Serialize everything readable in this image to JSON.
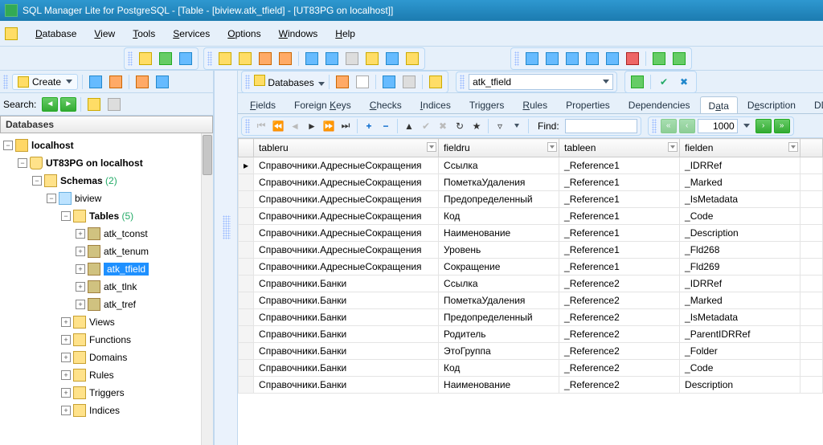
{
  "title": "SQL Manager Lite for PostgreSQL - [Table - [biview.atk_tfield] - [UT83PG on localhost]]",
  "menu": {
    "database": "Database",
    "view": "View",
    "tools": "Tools",
    "services": "Services",
    "options": "Options",
    "windows": "Windows",
    "help": "Help"
  },
  "left": {
    "create_label": "Create",
    "search_label": "Search:",
    "panel_title": "Databases",
    "host": "localhost",
    "db": "UT83PG on localhost",
    "schemas_label": "Schemas",
    "schemas_count": "(2)",
    "schema_name": "biview",
    "tables_label": "Tables",
    "tables_count": "(5)",
    "tables": [
      "atk_tconst",
      "atk_tenum",
      "atk_tfield",
      "atk_tlnk",
      "atk_tref"
    ],
    "views": "Views",
    "functions": "Functions",
    "domains": "Domains",
    "rules": "Rules",
    "triggers": "Triggers",
    "indices": "Indices"
  },
  "right": {
    "databases_label": "Databases",
    "selected_table": "atk_tfield",
    "tabs": [
      "Fields",
      "Foreign Keys",
      "Checks",
      "Indices",
      "Triggers",
      "Rules",
      "Properties",
      "Dependencies",
      "Data",
      "Description",
      "DD"
    ],
    "active_tab": 8,
    "find_label": "Find:",
    "find_value": "",
    "page_count": "1000",
    "columns": [
      "tableru",
      "fieldru",
      "tableen",
      "fielden"
    ],
    "rows": [
      [
        "Справочники.АдресныеСокращения",
        "Ссылка",
        "_Reference1",
        "_IDRRef"
      ],
      [
        "Справочники.АдресныеСокращения",
        "ПометкаУдаления",
        "_Reference1",
        "_Marked"
      ],
      [
        "Справочники.АдресныеСокращения",
        "Предопределенный",
        "_Reference1",
        "_IsMetadata"
      ],
      [
        "Справочники.АдресныеСокращения",
        "Код",
        "_Reference1",
        "_Code"
      ],
      [
        "Справочники.АдресныеСокращения",
        "Наименование",
        "_Reference1",
        "_Description"
      ],
      [
        "Справочники.АдресныеСокращения",
        "Уровень",
        "_Reference1",
        "_Fld268"
      ],
      [
        "Справочники.АдресныеСокращения",
        "Сокращение",
        "_Reference1",
        "_Fld269"
      ],
      [
        "Справочники.Банки",
        "Ссылка",
        "_Reference2",
        "_IDRRef"
      ],
      [
        "Справочники.Банки",
        "ПометкаУдаления",
        "_Reference2",
        "_Marked"
      ],
      [
        "Справочники.Банки",
        "Предопределенный",
        "_Reference2",
        "_IsMetadata"
      ],
      [
        "Справочники.Банки",
        "Родитель",
        "_Reference2",
        "_ParentIDRRef"
      ],
      [
        "Справочники.Банки",
        "ЭтоГруппа",
        "_Reference2",
        "_Folder"
      ],
      [
        "Справочники.Банки",
        "Код",
        "_Reference2",
        "_Code"
      ],
      [
        "Справочники.Банки",
        "Наименование",
        "_Reference2",
        "Description"
      ]
    ]
  }
}
